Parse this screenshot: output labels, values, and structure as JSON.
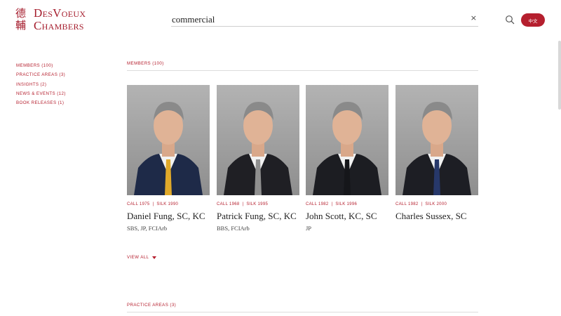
{
  "header": {
    "logo_chinese_line1": "德",
    "logo_chinese_line2": "輔",
    "logo_line1": "DesVoeux",
    "logo_line2": "Chambers",
    "search_value": "commercial",
    "clear_icon": "×",
    "language_button": "中文"
  },
  "sidebar": {
    "items": [
      {
        "label": "MEMBERS (100)"
      },
      {
        "label": "PRACTICE AREAS (3)"
      },
      {
        "label": "INSIGHTS (2)"
      },
      {
        "label": "NEWS & EVENTS (12)"
      },
      {
        "label": "BOOK RELEASES (1)"
      }
    ]
  },
  "members_section": {
    "title": "MEMBERS (100)",
    "members": [
      {
        "call": "CALL 1975",
        "silk": "SILK 1990",
        "name": "Daniel Fung, SC, KC",
        "postnominals": "SBS, JP, FCIArb",
        "tie_color": "#e0a92a",
        "suit_color": "#1e2a48"
      },
      {
        "call": "CALL 1968",
        "silk": "SILK 1995",
        "name": "Patrick Fung, SC, KC",
        "postnominals": "BBS, FCIArb",
        "tie_color": "#8f8f8f",
        "suit_color": "#1f1f24"
      },
      {
        "call": "CALL 1982",
        "silk": "SILK 1996",
        "name": "John Scott, KC, SC",
        "postnominals": "JP",
        "tie_color": "#15161a",
        "suit_color": "#1c1d22"
      },
      {
        "call": "CALL 1982",
        "silk": "SILK 2000",
        "name": "Charles Sussex, SC",
        "postnominals": "",
        "tie_color": "#27386a",
        "suit_color": "#1d1e24"
      }
    ],
    "view_all": "VIEW ALL"
  },
  "practice_section": {
    "title": "PRACTICE AREAS (3)"
  },
  "colors": {
    "accent": "#b51f2e",
    "text": "#222222"
  }
}
